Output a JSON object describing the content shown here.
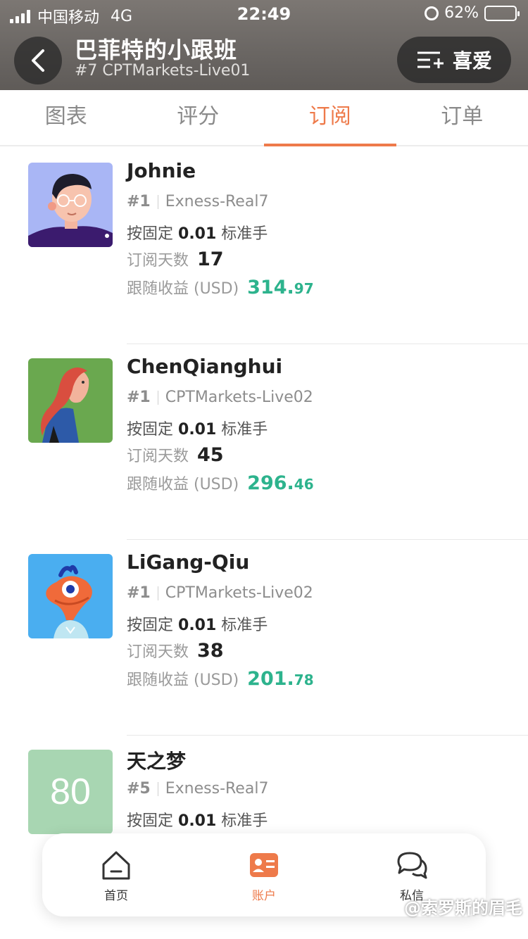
{
  "status_bar": {
    "carrier": "中国移动",
    "network": "4G",
    "time": "22:49",
    "battery": "62%",
    "battery_level": 0.62
  },
  "nav": {
    "title": "巴菲特的小跟班",
    "subtitle": "#7 CPTMarkets-Live01",
    "fav_label": "喜爱"
  },
  "tabs": [
    {
      "label": "图表"
    },
    {
      "label": "评分"
    },
    {
      "label": "订阅"
    },
    {
      "label": "订单"
    }
  ],
  "active_tab": "订阅",
  "subscriptions": [
    {
      "name": "Johnie",
      "rank": "#1",
      "account": "Exness-Real7",
      "fixed_prefix": "按固定",
      "lots": "0.01",
      "fixed_suffix": "标准手",
      "days_label": "订阅天数",
      "days": "17",
      "profit_label": "跟随收益 (USD)",
      "profit_int": "314.",
      "profit_dec": "97"
    },
    {
      "name": "ChenQianghui",
      "rank": "#1",
      "account": "CPTMarkets-Live02",
      "fixed_prefix": "按固定",
      "lots": "0.01",
      "fixed_suffix": "标准手",
      "days_label": "订阅天数",
      "days": "45",
      "profit_label": "跟随收益 (USD)",
      "profit_int": "296.",
      "profit_dec": "46"
    },
    {
      "name": "LiGang-Qiu",
      "rank": "#1",
      "account": "CPTMarkets-Live02",
      "fixed_prefix": "按固定",
      "lots": "0.01",
      "fixed_suffix": "标准手",
      "days_label": "订阅天数",
      "days": "38",
      "profit_label": "跟随收益 (USD)",
      "profit_int": "201.",
      "profit_dec": "78"
    },
    {
      "name": "天之梦",
      "avatar_text": "80",
      "rank": "#5",
      "account": "Exness-Real7",
      "fixed_prefix": "按固定",
      "lots": "0.01",
      "fixed_suffix": "标准手"
    }
  ],
  "bottom_nav": [
    {
      "label": "首页",
      "icon": "home-icon"
    },
    {
      "label": "账户",
      "icon": "account-card-icon"
    },
    {
      "label": "私信",
      "icon": "chat-bubbles-icon"
    }
  ],
  "watermark": "@索罗斯的眉毛",
  "colors": {
    "accent": "#ee7a4a",
    "profit": "#2db38d"
  }
}
